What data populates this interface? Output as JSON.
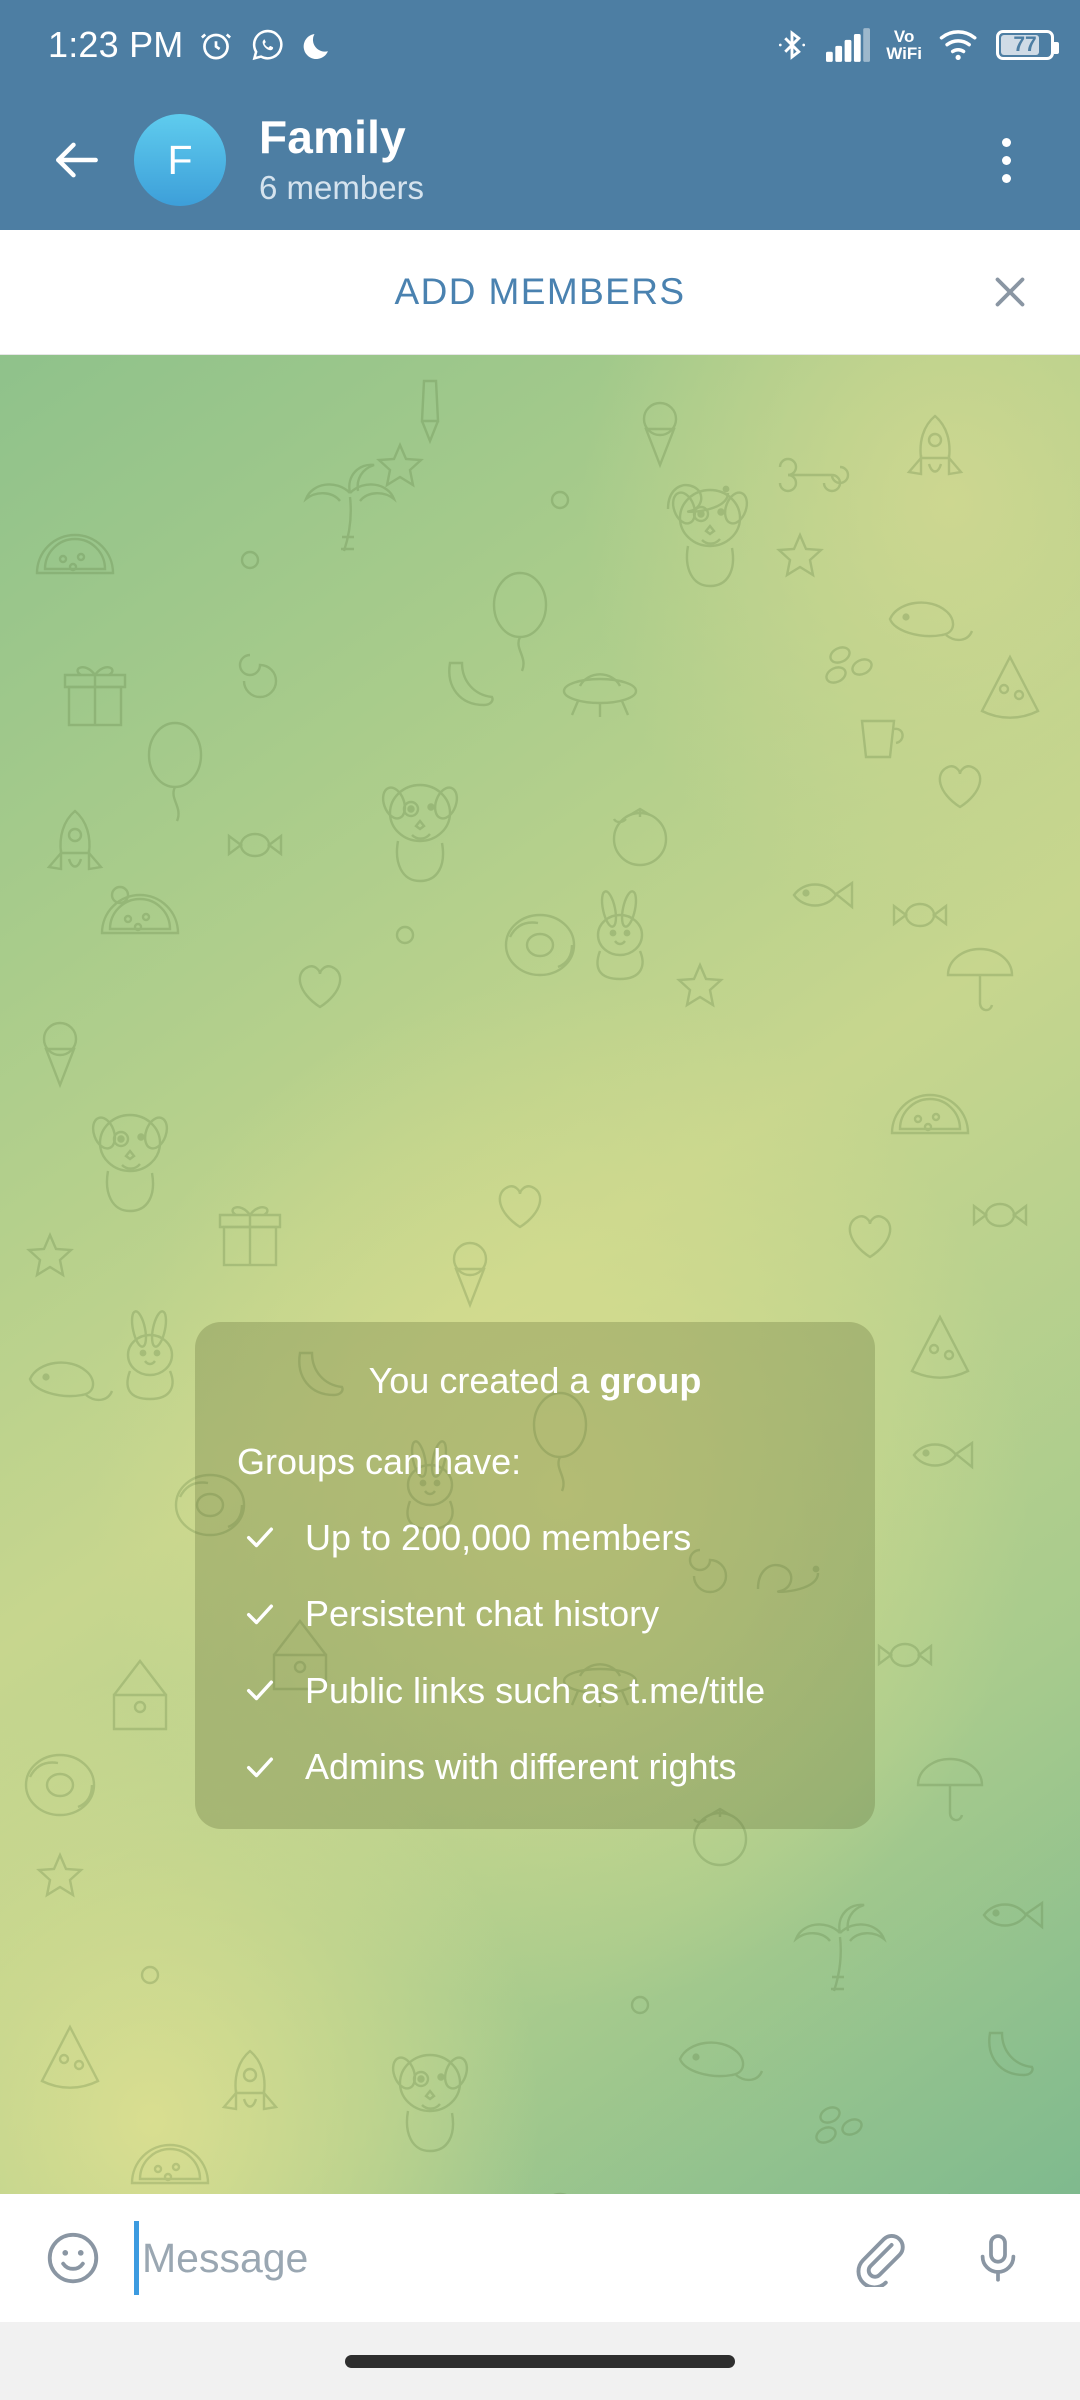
{
  "status_bar": {
    "time": "1:23 PM",
    "battery_percent": "77",
    "volte_line1": "Vo",
    "volte_line2": "WiFi",
    "icons": [
      "alarm-clock-icon",
      "whatsapp-icon",
      "crescent-moon-dnd-icon",
      "bluetooth-icon",
      "cellular-signal-icon",
      "vowifi-icon",
      "wifi-icon",
      "battery-icon"
    ]
  },
  "header": {
    "back_icon": "back-arrow-icon",
    "avatar_initial": "F",
    "title": "Family",
    "subtitle": "6 members",
    "menu_icon": "overflow-menu-icon",
    "background_color": "#4D7EA3"
  },
  "add_members_bar": {
    "label": "ADD MEMBERS",
    "close_icon": "close-icon",
    "accent_color": "#4A82B0"
  },
  "service_card": {
    "heading_prefix": "You created a ",
    "heading_bold": "group",
    "subheading": "Groups can have:",
    "features": [
      "Up to 200,000 members",
      "Persistent chat history",
      "Public links such as t.me/title",
      "Admins with different rights"
    ],
    "check_icon": "check-icon"
  },
  "input_bar": {
    "emoji_icon": "smiley-icon",
    "placeholder": "Message",
    "value": "",
    "attach_icon": "paperclip-icon",
    "mic_icon": "microphone-icon",
    "caret_color": "#3C9BE0"
  },
  "nav_bar": {
    "gesture_pill": "home-gesture-pill"
  }
}
